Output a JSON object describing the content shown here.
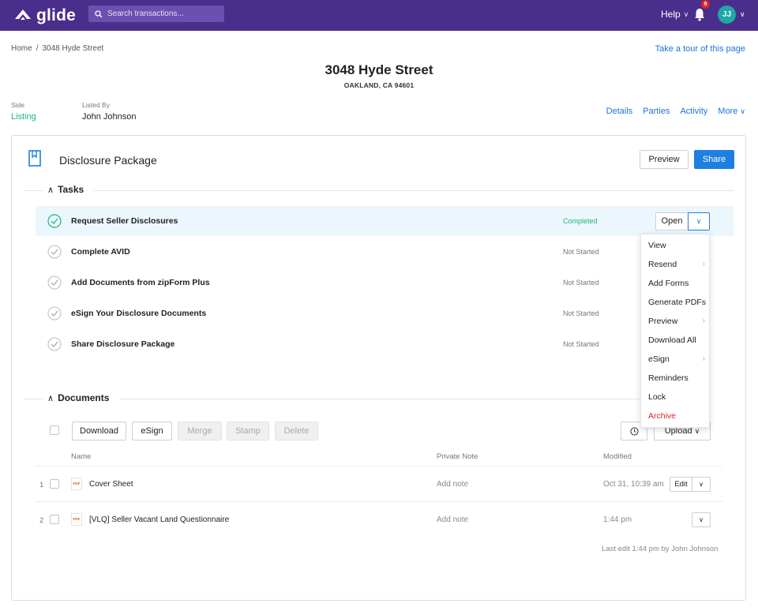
{
  "app": {
    "brand": "glide",
    "brand_color": "#4a2e8c",
    "accent": "#1d7fe0"
  },
  "topbar": {
    "search_placeholder": "Search transactions...",
    "help_label": "Help",
    "notification_count": "9",
    "avatar_initials": "JJ"
  },
  "breadcrumb": {
    "home": "Home",
    "separator": "/",
    "current": "3048 Hyde Street"
  },
  "tour_link": "Take a tour of this page",
  "header": {
    "title": "3048 Hyde Street",
    "subtitle": "OAKLAND, CA 94601"
  },
  "meta": {
    "side_label": "Side",
    "side_value": "Listing",
    "listed_by_label": "Listed By",
    "listed_by_value": "John Johnson"
  },
  "tabs": [
    "Details",
    "Parties",
    "Activity",
    "More"
  ],
  "package": {
    "title": "Disclosure Package",
    "preview_label": "Preview",
    "share_label": "Share"
  },
  "tasks_section": {
    "title": "Tasks",
    "items": [
      {
        "name": "Request Seller Disclosures",
        "status": "Completed"
      },
      {
        "name": "Complete AVID",
        "status": "Not Started"
      },
      {
        "name": "Add Documents from zipForm Plus",
        "status": "Not Started"
      },
      {
        "name": "eSign Your Disclosure Documents",
        "status": "Not Started"
      },
      {
        "name": "Share Disclosure Package",
        "status": "Not Started"
      }
    ],
    "open_label": "Open"
  },
  "dropdown_menu": {
    "items": [
      {
        "label": "View",
        "submenu": false
      },
      {
        "label": "Resend",
        "submenu": true
      },
      {
        "label": "Add Forms",
        "submenu": false
      },
      {
        "label": "Generate PDFs",
        "submenu": false
      },
      {
        "label": "Preview",
        "submenu": true
      },
      {
        "label": "Download All",
        "submenu": false
      },
      {
        "label": "eSign",
        "submenu": true
      },
      {
        "label": "Reminders",
        "submenu": false
      },
      {
        "label": "Lock",
        "submenu": false
      },
      {
        "label": "Archive",
        "submenu": false,
        "danger": true
      }
    ]
  },
  "documents_section": {
    "title": "Documents",
    "toolbar": {
      "download": "Download",
      "esign": "eSign",
      "merge": "Merge",
      "stamp": "Stamp",
      "delete": "Delete",
      "upload": "Upload"
    },
    "columns": {
      "name": "Name",
      "note": "Private Note",
      "modified": "Modified"
    },
    "rows": [
      {
        "num": "1",
        "file_type": "PDF",
        "name": "Cover Sheet",
        "note": "Add note",
        "modified": "Oct 31, 10:39 am",
        "edit_label": "Edit"
      },
      {
        "num": "2",
        "file_type": "PDF",
        "name": "[VLQ] Seller Vacant Land Questionnaire",
        "note": "Add note",
        "modified": "1:44 pm"
      }
    ],
    "last_edit": "Last edit 1:44 pm by John Johnson"
  }
}
